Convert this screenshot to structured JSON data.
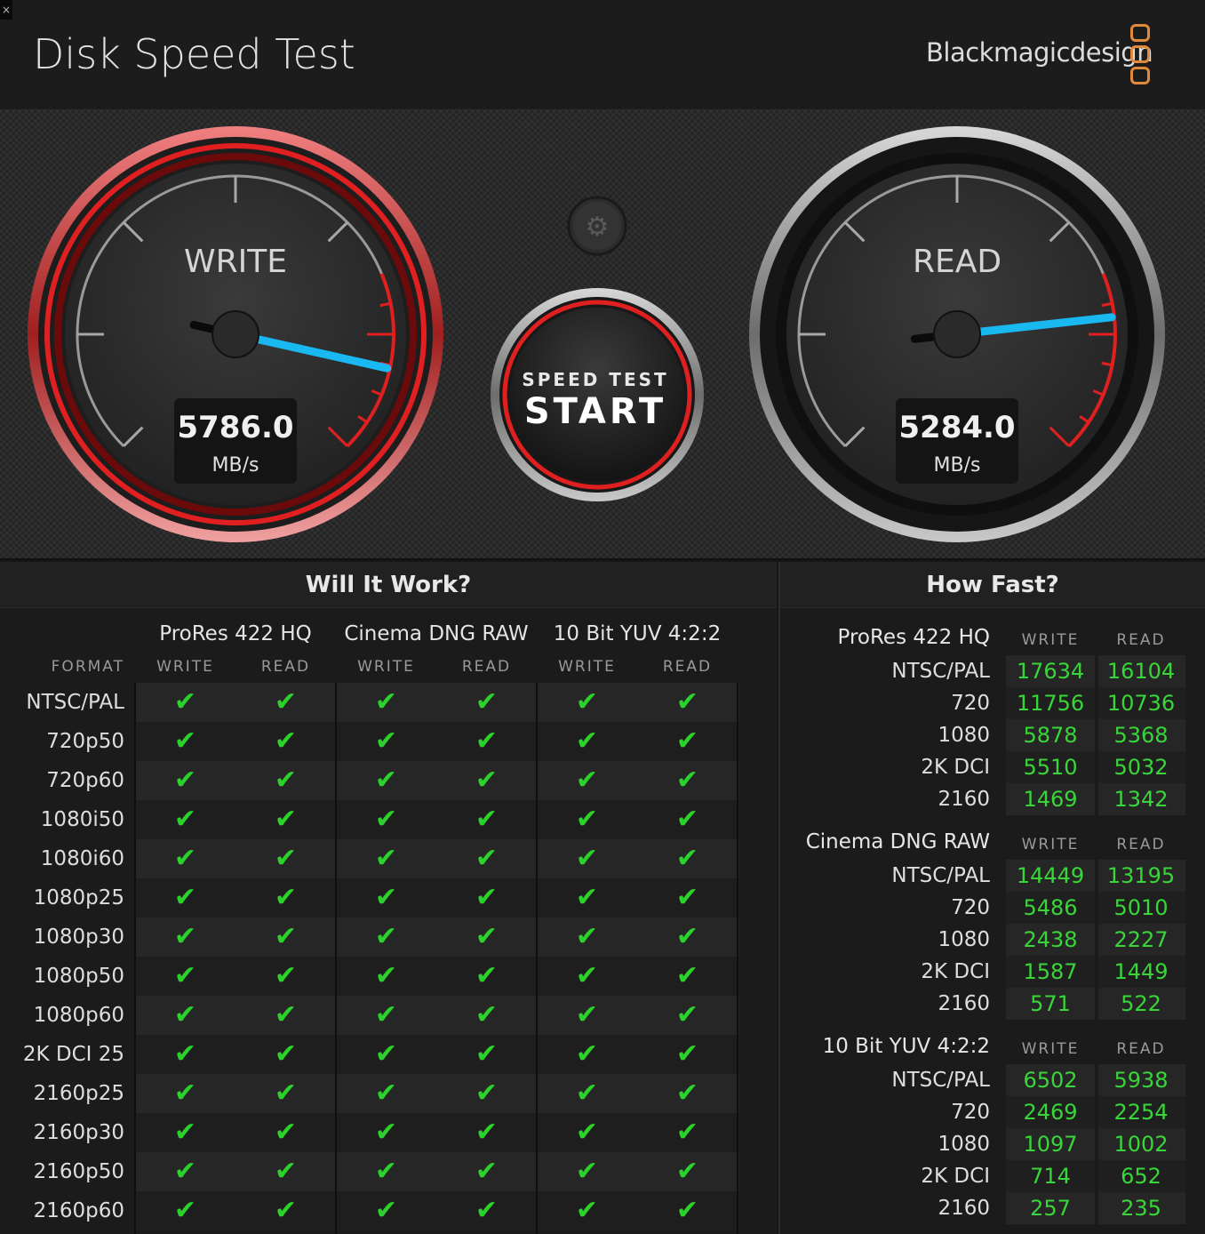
{
  "header": {
    "title": "Disk Speed Test",
    "brand": "Blackmagicdesign",
    "close_glyph": "×"
  },
  "gauges": {
    "write": {
      "label": "WRITE",
      "value": "5786.0",
      "unit": "MB/s",
      "needle_fraction": 0.88
    },
    "read": {
      "label": "READ",
      "value": "5284.0",
      "unit": "MB/s",
      "needle_fraction": 0.81
    },
    "start_button": {
      "line1": "SPEED TEST",
      "line2": "START"
    },
    "settings_icon": "gear-icon"
  },
  "will_it_work": {
    "title": "Will It Work?",
    "format_header": "FORMAT",
    "codecs": [
      "ProRes 422 HQ",
      "Cinema DNG RAW",
      "10 Bit YUV 4:2:2"
    ],
    "column_headers": [
      "WRITE",
      "READ",
      "WRITE",
      "READ",
      "WRITE",
      "READ"
    ],
    "check_glyph": "✔",
    "rows": [
      {
        "format": "NTSC/PAL",
        "checks": [
          true,
          true,
          true,
          true,
          true,
          true
        ]
      },
      {
        "format": "720p50",
        "checks": [
          true,
          true,
          true,
          true,
          true,
          true
        ]
      },
      {
        "format": "720p60",
        "checks": [
          true,
          true,
          true,
          true,
          true,
          true
        ]
      },
      {
        "format": "1080i50",
        "checks": [
          true,
          true,
          true,
          true,
          true,
          true
        ]
      },
      {
        "format": "1080i60",
        "checks": [
          true,
          true,
          true,
          true,
          true,
          true
        ]
      },
      {
        "format": "1080p25",
        "checks": [
          true,
          true,
          true,
          true,
          true,
          true
        ]
      },
      {
        "format": "1080p30",
        "checks": [
          true,
          true,
          true,
          true,
          true,
          true
        ]
      },
      {
        "format": "1080p50",
        "checks": [
          true,
          true,
          true,
          true,
          true,
          true
        ]
      },
      {
        "format": "1080p60",
        "checks": [
          true,
          true,
          true,
          true,
          true,
          true
        ]
      },
      {
        "format": "2K DCI 25",
        "checks": [
          true,
          true,
          true,
          true,
          true,
          true
        ]
      },
      {
        "format": "2160p25",
        "checks": [
          true,
          true,
          true,
          true,
          true,
          true
        ]
      },
      {
        "format": "2160p30",
        "checks": [
          true,
          true,
          true,
          true,
          true,
          true
        ]
      },
      {
        "format": "2160p50",
        "checks": [
          true,
          true,
          true,
          true,
          true,
          true
        ]
      },
      {
        "format": "2160p60",
        "checks": [
          true,
          true,
          true,
          true,
          true,
          true
        ]
      }
    ]
  },
  "how_fast": {
    "title": "How Fast?",
    "groups": [
      {
        "codec": "ProRes 422 HQ",
        "write_header": "WRITE",
        "read_header": "READ",
        "rows": [
          {
            "format": "NTSC/PAL",
            "write": "17634",
            "read": "16104"
          },
          {
            "format": "720",
            "write": "11756",
            "read": "10736"
          },
          {
            "format": "1080",
            "write": "5878",
            "read": "5368"
          },
          {
            "format": "2K DCI",
            "write": "5510",
            "read": "5032"
          },
          {
            "format": "2160",
            "write": "1469",
            "read": "1342"
          }
        ]
      },
      {
        "codec": "Cinema DNG RAW",
        "write_header": "WRITE",
        "read_header": "READ",
        "rows": [
          {
            "format": "NTSC/PAL",
            "write": "14449",
            "read": "13195"
          },
          {
            "format": "720",
            "write": "5486",
            "read": "5010"
          },
          {
            "format": "1080",
            "write": "2438",
            "read": "2227"
          },
          {
            "format": "2K DCI",
            "write": "1587",
            "read": "1449"
          },
          {
            "format": "2160",
            "write": "571",
            "read": "522"
          }
        ]
      },
      {
        "codec": "10 Bit YUV 4:2:2",
        "write_header": "WRITE",
        "read_header": "READ",
        "rows": [
          {
            "format": "NTSC/PAL",
            "write": "6502",
            "read": "5938"
          },
          {
            "format": "720",
            "write": "2469",
            "read": "2254"
          },
          {
            "format": "1080",
            "write": "1097",
            "read": "1002"
          },
          {
            "format": "2K DCI",
            "write": "714",
            "read": "652"
          },
          {
            "format": "2160",
            "write": "257",
            "read": "235"
          }
        ]
      }
    ]
  },
  "colors": {
    "accent_red": "#e02020",
    "needle_blue": "#1ab8f0",
    "check_green": "#2bd22b",
    "value_green": "#38d638",
    "brand_orange": "#e08a3c"
  }
}
